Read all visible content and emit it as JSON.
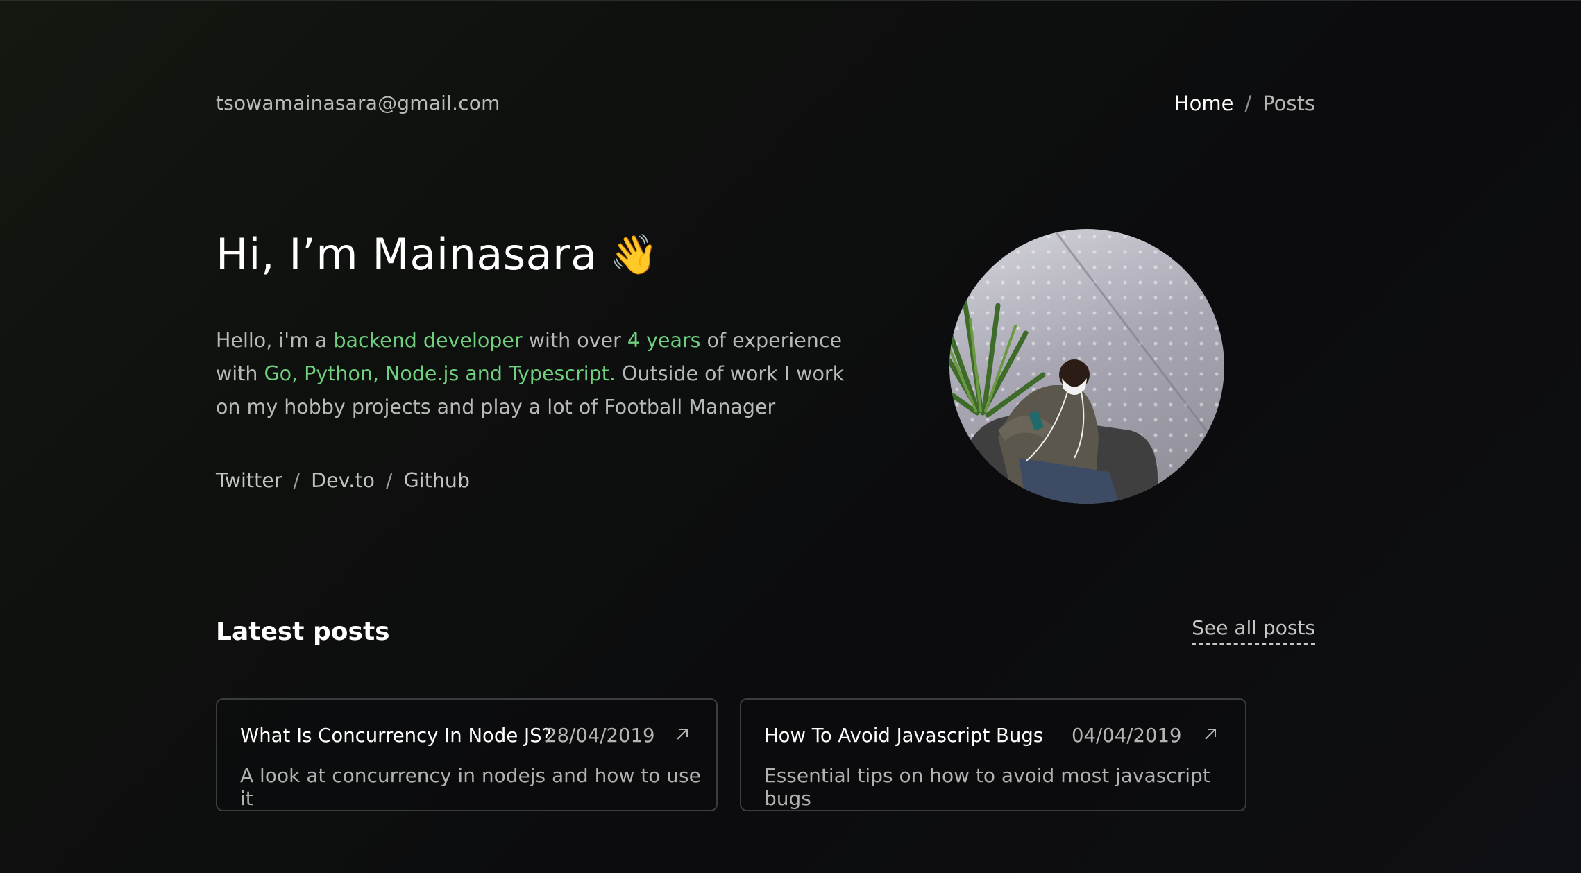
{
  "header": {
    "email": "tsowamainasara@gmail.com",
    "nav": [
      {
        "label": "Home",
        "active": true
      },
      {
        "label": "Posts",
        "active": false
      }
    ],
    "nav_separator": "/"
  },
  "hero": {
    "title": "Hi, I’m Mainasara",
    "title_emoji": "👋",
    "bio": {
      "t1": "Hello, i'm a ",
      "h1": "backend developer",
      "t2": " with over ",
      "h2": "4 years",
      "t3": " of experience with ",
      "h3": "Go, Python, Node.js and Typescript.",
      "t4": " Outside of work I work on my hobby projects and play a lot of Football Manager"
    },
    "socials": [
      "Twitter",
      "Dev.to",
      "Github"
    ],
    "social_separator": "/",
    "avatar_icon": "profile-photo"
  },
  "latest_posts": {
    "title": "Latest posts",
    "see_all": "See all posts",
    "posts": [
      {
        "title": "What Is Concurrency In Node JS?",
        "date": "28/04/2019",
        "description": "A look at concurrency in nodejs and how to use it",
        "icon": "arrow-up-right-icon"
      },
      {
        "title": "How To Avoid Javascript Bugs",
        "date": "04/04/2019",
        "description": "Essential tips on how to avoid most javascript bugs",
        "icon": "arrow-up-right-icon"
      }
    ]
  },
  "colors": {
    "accent_green": "#6fd07f",
    "background": "#0d0e0f",
    "text_primary": "#ffffff",
    "text_secondary": "#b8bab7"
  }
}
